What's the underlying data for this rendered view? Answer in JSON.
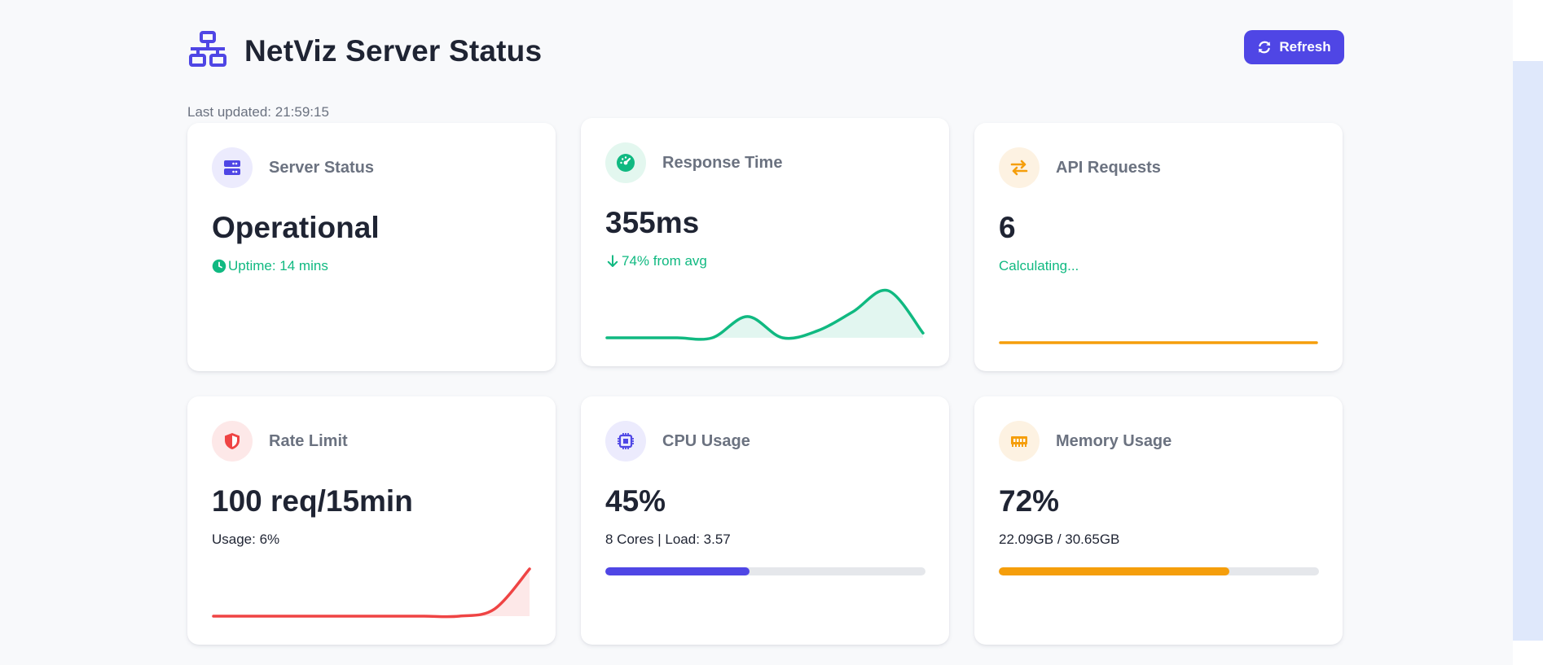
{
  "app": {
    "title": "NetViz Server Status",
    "refresh_label": "Refresh",
    "last_updated": "Last updated: 21:59:15"
  },
  "colors": {
    "accent": "#4f46e5",
    "green": "#10b981",
    "orange": "#f59e0b",
    "red": "#ef4444"
  },
  "cards": [
    {
      "label": "Server Status",
      "value": "Operational",
      "sub": "Uptime: 14 mins",
      "icon": "server-icon"
    },
    {
      "label": "Response Time",
      "value": "355ms",
      "sub": "74% from avg",
      "icon": "gauge-icon",
      "trend": [
        0,
        0,
        0,
        0,
        0.45,
        0,
        0.15,
        0.55,
        1.0,
        0.1
      ]
    },
    {
      "label": "API Requests",
      "value": "6",
      "sub": "Calculating...",
      "icon": "arrows-exchange-icon",
      "trend": [
        0,
        0,
        0,
        0,
        0,
        0,
        0,
        0,
        0,
        0
      ]
    },
    {
      "label": "Rate Limit",
      "value": "100 req/15min",
      "sub": "Usage: 6%",
      "icon": "shield-icon",
      "trend": [
        0,
        0,
        0,
        0,
        0,
        0,
        0,
        0,
        0.15,
        1.0
      ]
    },
    {
      "label": "CPU Usage",
      "value": "45%",
      "sub": "8 Cores | Load: 3.57",
      "icon": "cpu-icon",
      "progress": 0.45
    },
    {
      "label": "Memory Usage",
      "value": "72%",
      "sub": "22.09GB / 30.65GB",
      "icon": "memory-icon",
      "progress": 0.72
    }
  ]
}
